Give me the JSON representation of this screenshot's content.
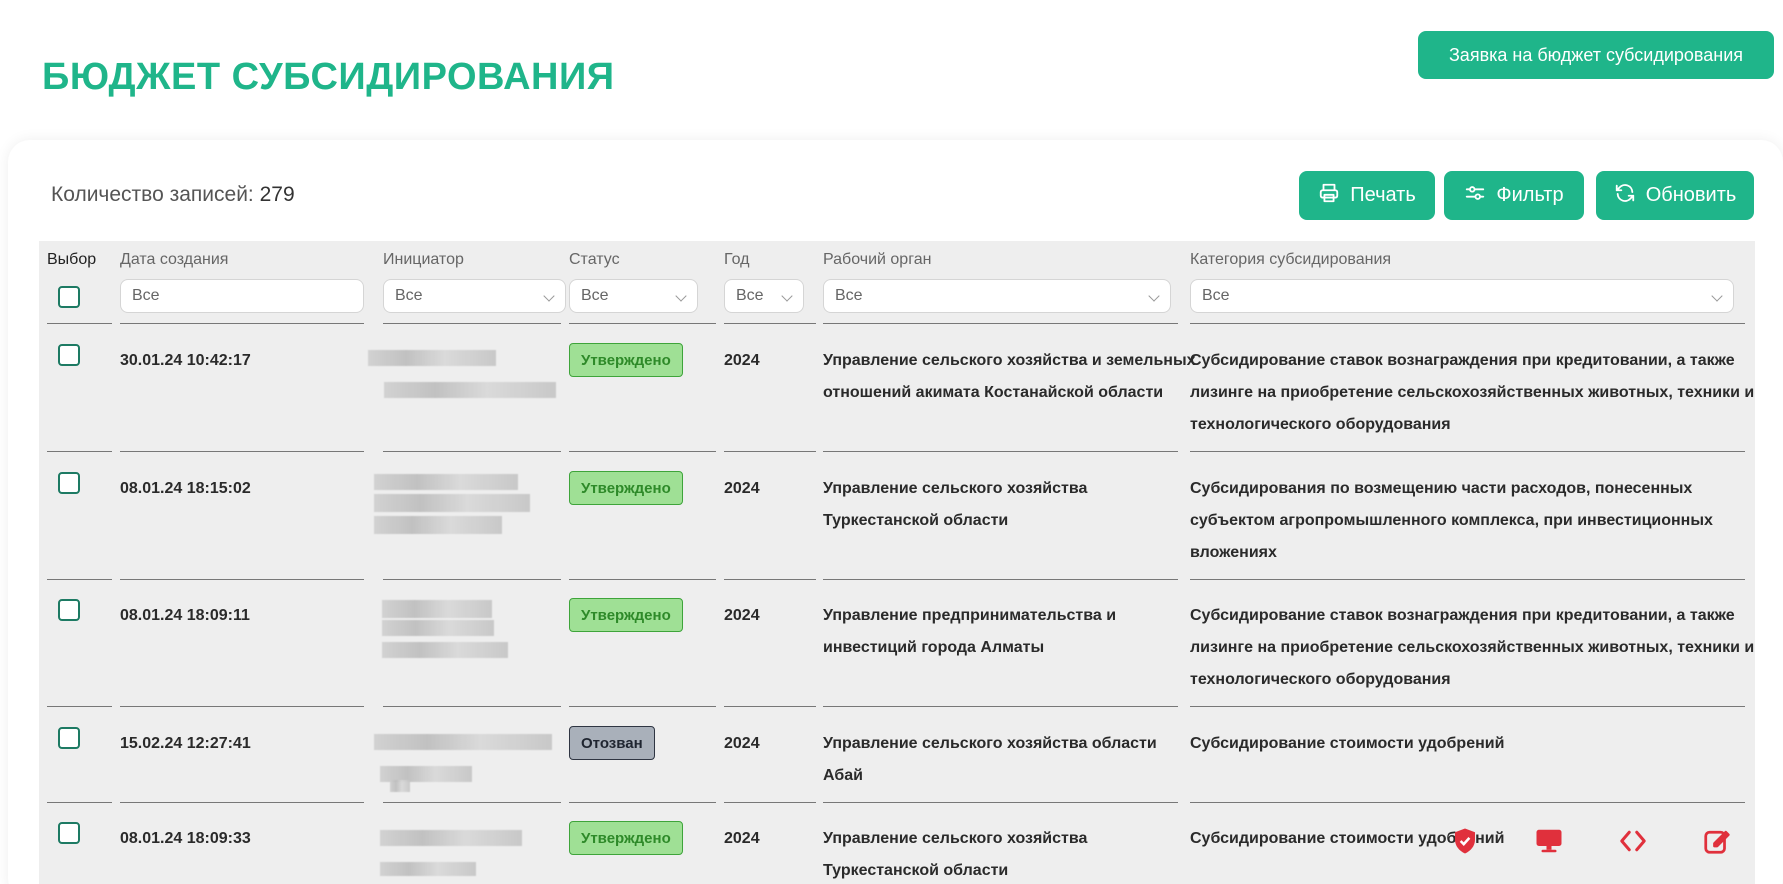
{
  "header": {
    "title": "БЮДЖЕТ СУБСИДИРОВАНИЯ",
    "request_button": "Заявка на бюджет субсидирования"
  },
  "toolbar": {
    "records_label": "Количество записей:",
    "records_count": "279",
    "print_label": "Печать",
    "filter_label": "Фильтр",
    "refresh_label": "Обновить"
  },
  "table": {
    "columns": {
      "select": "Выбор",
      "created": "Дата создания",
      "initiator": "Инициатор",
      "status": "Статус",
      "year": "Год",
      "body": "Рабочий орган",
      "category": "Категория субсидирования"
    },
    "filters": {
      "created": "Все",
      "initiator": "Все",
      "status": "Все",
      "year": "Все",
      "body": "Все",
      "category": "Все"
    },
    "rows": [
      {
        "date": "30.01.24 10:42:17",
        "status": "Утверждено",
        "year": "2024",
        "body_lines": [
          "Управление сельского хозяйства и земельных",
          "отношений акимата Костанайской области"
        ],
        "category_lines": [
          "Субсидирование ставок вознаграждения при кредитовании, а также",
          "лизинге на приобретение сельскохозяйственных животных, техники и",
          "технологического оборудования"
        ]
      },
      {
        "date": "08.01.24 18:15:02",
        "status": "Утверждено",
        "year": "2024",
        "body_lines": [
          "Управление сельского хозяйства",
          "Туркестанской области"
        ],
        "category_lines": [
          "Субсидирования по возмещению части расходов, понесенных",
          "субъектом агропромышленного комплекса, при инвестиционных",
          "вложениях"
        ]
      },
      {
        "date": "08.01.24 18:09:11",
        "status": "Утверждено",
        "year": "2024",
        "body_lines": [
          "Управление предпринимательства и",
          "инвестиций города Алматы"
        ],
        "category_lines": [
          "Субсидирование ставок вознаграждения при кредитовании, а также",
          "лизинге на приобретение сельскохозяйственных животных, техники и",
          "технологического оборудования"
        ]
      },
      {
        "date": "15.02.24 12:27:41",
        "status": "Отозван",
        "year": "2024",
        "body_lines": [
          "Управление сельского хозяйства области",
          "Абай"
        ],
        "category_lines": [
          "Субсидирование стоимости удобрений"
        ]
      },
      {
        "date": "08.01.24 18:09:33",
        "status": "Утверждено",
        "year": "2024",
        "body_lines": [
          "Управление сельского хозяйства",
          "Туркестанской области"
        ],
        "category_lines": [
          "Субсидирование стоимости удобрений"
        ]
      }
    ]
  },
  "colors": {
    "accent": "#1fb58a",
    "approved_bg": "#9fe095",
    "revoked_bg": "#a9b0ba",
    "fab_red": "#e0303c"
  },
  "icons": [
    "printer-icon",
    "sliders-icon",
    "refresh-icon",
    "shield-icon",
    "monitor-icon",
    "code-icon",
    "edit-icon"
  ]
}
